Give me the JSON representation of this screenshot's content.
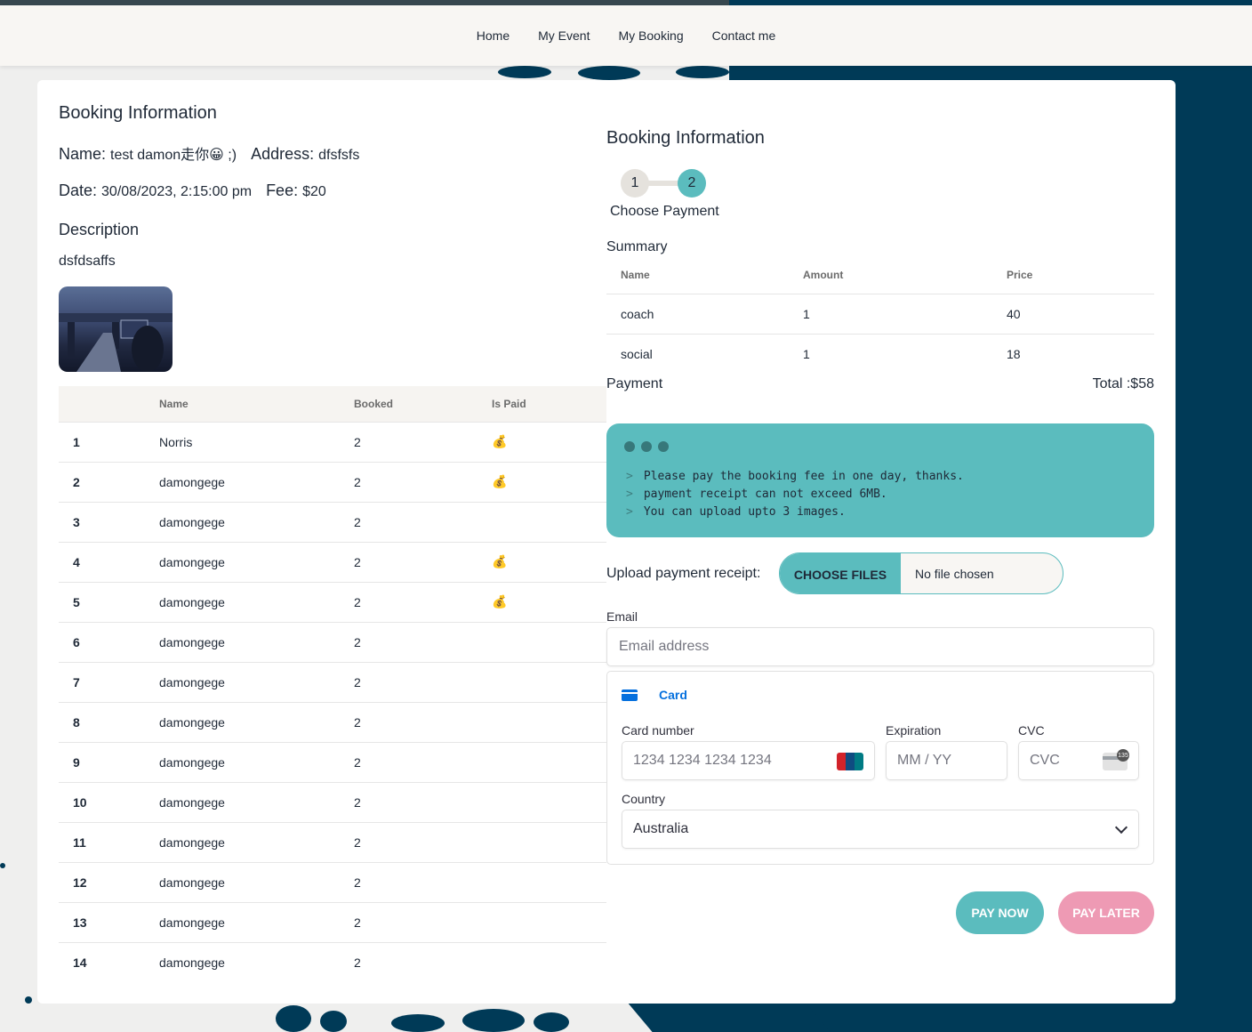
{
  "nav": {
    "items": [
      "Home",
      "My Event",
      "My Booking",
      "Contact me"
    ]
  },
  "booking": {
    "title": "Booking Information",
    "name_label": "Name:",
    "name_value": "test damon走你😀 ;)",
    "address_label": "Address:",
    "address_value": "dfsfsfs",
    "date_label": "Date:",
    "date_value": "30/08/2023, 2:15:00 pm",
    "fee_label": "Fee:",
    "fee_value": "$20",
    "description_label": "Description",
    "description_value": "dsfdsaffs"
  },
  "bookers_table": {
    "headers": [
      "",
      "Name",
      "Booked",
      "Is Paid"
    ],
    "rows": [
      {
        "no": "1",
        "name": "Norris",
        "booked": "2",
        "paid": "💰"
      },
      {
        "no": "2",
        "name": "damongege",
        "booked": "2",
        "paid": "💰"
      },
      {
        "no": "3",
        "name": "damongege",
        "booked": "2",
        "paid": ""
      },
      {
        "no": "4",
        "name": "damongege",
        "booked": "2",
        "paid": "💰"
      },
      {
        "no": "5",
        "name": "damongege",
        "booked": "2",
        "paid": "💰"
      },
      {
        "no": "6",
        "name": "damongege",
        "booked": "2",
        "paid": ""
      },
      {
        "no": "7",
        "name": "damongege",
        "booked": "2",
        "paid": ""
      },
      {
        "no": "8",
        "name": "damongege",
        "booked": "2",
        "paid": ""
      },
      {
        "no": "9",
        "name": "damongege",
        "booked": "2",
        "paid": ""
      },
      {
        "no": "10",
        "name": "damongege",
        "booked": "2",
        "paid": ""
      },
      {
        "no": "11",
        "name": "damongege",
        "booked": "2",
        "paid": ""
      },
      {
        "no": "12",
        "name": "damongege",
        "booked": "2",
        "paid": ""
      },
      {
        "no": "13",
        "name": "damongege",
        "booked": "2",
        "paid": ""
      },
      {
        "no": "14",
        "name": "damongege",
        "booked": "2",
        "paid": ""
      }
    ]
  },
  "payment_panel": {
    "title": "Booking Information",
    "steps": [
      "1",
      "2"
    ],
    "active_step": 2,
    "step_label": "Choose Payment",
    "summary_label": "Summary",
    "summary_headers": [
      "Name",
      "Amount",
      "Price"
    ],
    "summary_rows": [
      {
        "name": "coach",
        "amount": "1",
        "price": "40"
      },
      {
        "name": "social",
        "amount": "1",
        "price": "18"
      }
    ],
    "payment_label": "Payment",
    "total": "Total :$58",
    "notice_lines": [
      "Please pay the booking fee in one day, thanks.",
      "payment receipt can not exceed 6MB.",
      "You can upload upto 3 images."
    ],
    "notice_prompt": ">",
    "upload_label": "Upload payment receipt:",
    "choose_files": "CHOOSE FILES",
    "file_status": "No file chosen",
    "email_label": "Email",
    "email_placeholder": "Email address",
    "card_tab": "Card",
    "card_number_label": "Card number",
    "card_number_placeholder": "1234 1234 1234 1234",
    "expiration_label": "Expiration",
    "expiration_placeholder": "MM / YY",
    "cvc_label": "CVC",
    "cvc_placeholder": "CVC",
    "cvc_icon_text": "135",
    "country_label": "Country",
    "country_value": "Australia",
    "pay_now": "PAY NOW",
    "pay_later": "PAY LATER"
  },
  "colors": {
    "accent": "#5bbcbe",
    "pay_later": "#ee9ab4",
    "background_dark": "#003a57",
    "card_link": "#0570de"
  }
}
